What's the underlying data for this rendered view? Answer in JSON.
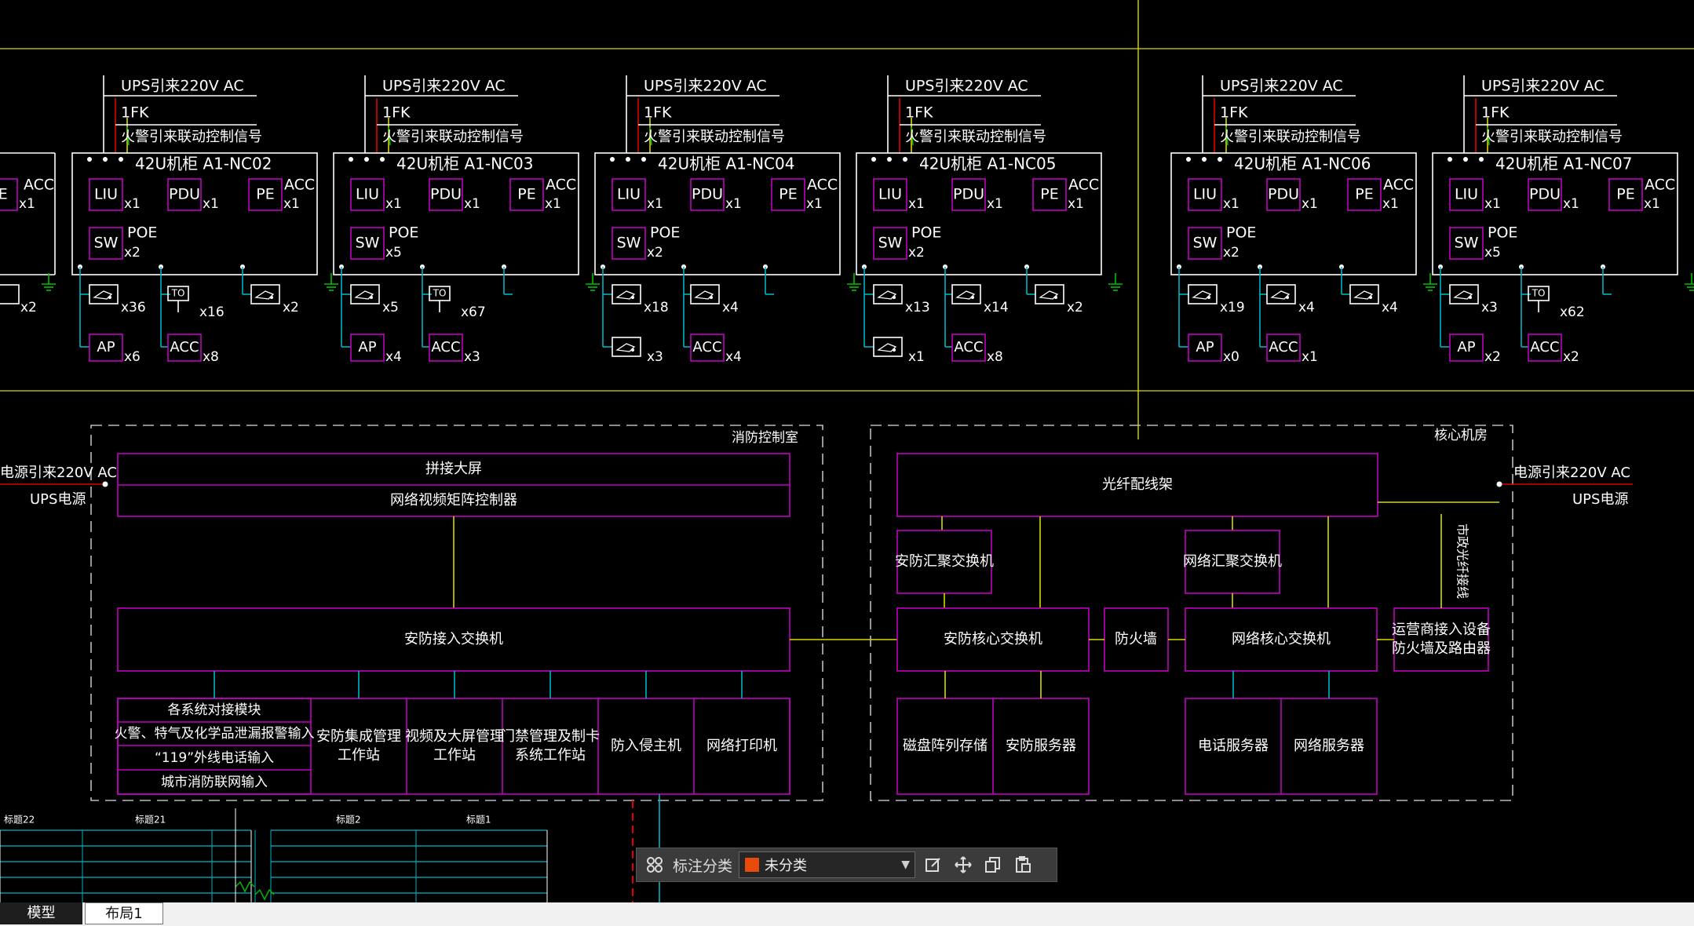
{
  "colors": {
    "background": "#000000",
    "magenta": "#c000c0",
    "white": "#ffffff",
    "yellow": "#d8d800",
    "cyan": "#00b4c4",
    "green": "#00c000",
    "red": "#e00000",
    "accent_swatch": "#e84a0c"
  },
  "cabinets": [
    {
      "label": "42U机柜 A1-NC02",
      "ups": "UPS引来220V AC",
      "fk": "1FK",
      "fire": "火警引来联动控制信号",
      "liu": "LIU",
      "pdu": "PDU",
      "pe": "PE",
      "acc_top": "ACC",
      "sw": "SW",
      "poe": "POE",
      "x1": "x1",
      "sw_count": "x2",
      "d1_count": "x36",
      "d2_label": "TO",
      "d2_count": "x16",
      "d3_count": "x2",
      "b1_label": "AP",
      "b1_count": "x6",
      "b2_label": "ACC",
      "b2_count": "x8"
    },
    {
      "label": "42U机柜 A1-NC03",
      "ups": "UPS引来220V AC",
      "fk": "1FK",
      "fire": "火警引来联动控制信号",
      "liu": "LIU",
      "pdu": "PDU",
      "pe": "PE",
      "acc_top": "ACC",
      "sw": "SW",
      "poe": "POE",
      "x1": "x1",
      "sw_count": "x5",
      "d1_count": "x5",
      "d2_label": "TO",
      "d2_count": "x67",
      "d3_count": "",
      "b1_label": "AP",
      "b1_count": "x4",
      "b2_label": "ACC",
      "b2_count": "x3"
    },
    {
      "label": "42U机柜 A1-NC04",
      "ups": "UPS引来220V AC",
      "fk": "1FK",
      "fire": "火警引来联动控制信号",
      "liu": "LIU",
      "pdu": "PDU",
      "pe": "PE",
      "acc_top": "ACC",
      "sw": "SW",
      "poe": "POE",
      "x1": "x1",
      "sw_count": "x2",
      "d1_count": "x18",
      "d2_label": "",
      "d2_count": "x4",
      "d3_count": "",
      "b1_label": "",
      "b1_count": "x3",
      "b2_label": "ACC",
      "b2_count": "x4"
    },
    {
      "label": "42U机柜 A1-NC05",
      "ups": "UPS引来220V AC",
      "fk": "1FK",
      "fire": "火警引来联动控制信号",
      "liu": "LIU",
      "pdu": "PDU",
      "pe": "PE",
      "acc_top": "ACC",
      "sw": "SW",
      "poe": "POE",
      "x1": "x1",
      "sw_count": "x2",
      "d1_count": "x13",
      "d2_label": "",
      "d2_count": "x14",
      "d3_count": "x2",
      "b1_label": "",
      "b1_count": "x1",
      "b2_label": "ACC",
      "b2_count": "x8"
    },
    {
      "label": "42U机柜 A1-NC06",
      "ups": "UPS引来220V AC",
      "fk": "1FK",
      "fire": "火警引来联动控制信号",
      "liu": "LIU",
      "pdu": "PDU",
      "pe": "PE",
      "acc_top": "ACC",
      "sw": "SW",
      "poe": "POE",
      "x1": "x1",
      "sw_count": "x2",
      "d1_count": "x19",
      "d2_label": "",
      "d2_count": "x4",
      "d3_count": "x4",
      "b1_label": "AP",
      "b1_count": "x0",
      "b2_label": "ACC",
      "b2_count": "x1"
    },
    {
      "label": "42U机柜 A1-NC07",
      "ups": "UPS引来220V AC",
      "fk": "1FK",
      "fire": "火警引来联动控制信号",
      "liu": "LIU",
      "pdu": "PDU",
      "pe": "PE",
      "acc_top": "ACC",
      "sw": "SW",
      "poe": "POE",
      "x1": "x1",
      "sw_count": "x5",
      "d1_count": "x3",
      "d2_label": "TO",
      "d2_count": "x62",
      "d3_count": "",
      "b1_label": "AP",
      "b1_count": "x2",
      "b2_label": "ACC",
      "b2_count": "x2"
    }
  ],
  "partial_cabinet": {
    "pe": "PE",
    "acc": "ACC",
    "x1": "x1",
    "count": "x2"
  },
  "fire_room": {
    "title": "消防控制室",
    "power_in": "电源引来220V AC",
    "ups": "UPS电源",
    "screen": "拼接大屏",
    "matrix": "网络视频矩阵控制器",
    "access_switch": "安防接入交换机",
    "interface_module": "各系统对接模块",
    "interface_rows": [
      "火警、特气及化学品泄漏报警输入",
      "“119”外线电话输入",
      "城市消防联网输入"
    ],
    "workstations": [
      "安防集成管理\n工作站",
      "视频及大屏管理\n工作站",
      "门禁管理及制卡\n系统工作站",
      "防入侵主机",
      "网络打印机"
    ]
  },
  "core_room": {
    "title": "核心机房",
    "power_in": "电源引来220V AC",
    "ups": "UPS电源",
    "odf": "光纤配线架",
    "sec_agg": "安防汇聚交换机",
    "net_agg": "网络汇聚交换机",
    "sec_core": "安防核心交换机",
    "firewall": "防火墙",
    "net_core": "网络核心交换机",
    "operator": "运营商接入设备\n防火墙及路由器",
    "fiber_label": "市政光纤接线",
    "storage": "磁盘阵列存储",
    "sec_server": "安防服务器",
    "phone_server": "电话服务器",
    "net_server": "网络服务器"
  },
  "floor_labels": [
    "标题22",
    "标题21",
    "标题2",
    "标题1"
  ],
  "toolbar": {
    "label": "标注分类",
    "selected": "未分类",
    "icons": [
      "grid-icon",
      "edit-icon",
      "move-icon",
      "copy-icon",
      "paste-icon"
    ]
  },
  "tabs": [
    "模型",
    "布局1"
  ]
}
